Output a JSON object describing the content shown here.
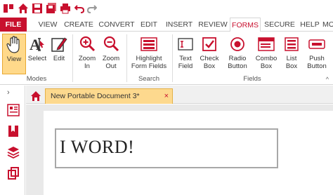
{
  "quick_access": {
    "icons": [
      "app-logo-icon",
      "home-icon",
      "save-icon",
      "save-all-icon",
      "print-icon",
      "undo-icon",
      "redo-icon"
    ]
  },
  "menu": {
    "file": "FILE",
    "items": [
      "VIEW",
      "CREATE",
      "CONVERT",
      "EDIT",
      "INSERT",
      "REVIEW",
      "FORMS",
      "SECURE",
      "HELP",
      "MO"
    ],
    "active": "FORMS"
  },
  "ribbon": {
    "buttons": {
      "view": [
        "View"
      ],
      "select": [
        "Select"
      ],
      "edit": [
        "Edit"
      ],
      "zoom_in": [
        "Zoom",
        "In"
      ],
      "zoom_out": [
        "Zoom",
        "Out"
      ],
      "highlight": [
        "Highlight",
        "Form Fields"
      ],
      "text_field": [
        "Text",
        "Field"
      ],
      "check_box": [
        "Check",
        "Box"
      ],
      "radio_button": [
        "Radio",
        "Button"
      ],
      "combo_box": [
        "Combo",
        "Box"
      ],
      "list_box": [
        "List",
        "Box"
      ],
      "push_button": [
        "Push",
        "Button"
      ]
    },
    "groups": {
      "modes": "Modes",
      "search": "Search",
      "fields": "Fields"
    },
    "collapse_glyph": "^"
  },
  "tabs": {
    "document_title": "New Portable Document 3*",
    "close_glyph": "×"
  },
  "document": {
    "text_field_value": "I WORD!"
  },
  "colors": {
    "accent": "#c8102e",
    "selected_bg": "#ffd98a",
    "tab_bg": "#fdd98e"
  }
}
